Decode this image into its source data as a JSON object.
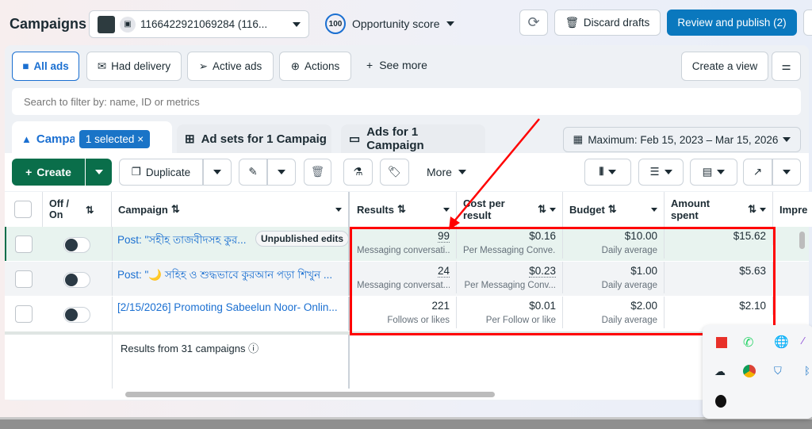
{
  "header": {
    "title": "Campaigns",
    "account": "1166422921069284 (116...",
    "opportunity_score": "100",
    "opportunity_label": "Opportunity score",
    "discard": "Discard drafts",
    "publish": "Review and publish (2)"
  },
  "filters": {
    "items": [
      "All ads",
      "Had delivery",
      "Active ads",
      "Actions"
    ],
    "see_more": "See more",
    "create_view": "Create a view"
  },
  "search": {
    "placeholder": "Search to filter by: name, ID or metrics"
  },
  "tabs": {
    "campaigns": "Campai",
    "selected": "1 selected",
    "adsets": "Ad sets for 1 Campaig",
    "ads": "Ads for 1 Campaign"
  },
  "date_range": "Maximum: Feb 15, 2023 – Mar 15, 2026",
  "toolbar": {
    "create": "Create",
    "duplicate": "Duplicate",
    "more": "More"
  },
  "table": {
    "headers": {
      "toggle": "Off / On",
      "campaign": "Campaign",
      "results": "Results",
      "cost": "Cost per result",
      "budget": "Budget",
      "amount": "Amount spent",
      "impressions": "Impre"
    },
    "rows": [
      {
        "name": "Post: \"সহীহ তাজবীদসহ কুর...",
        "badge": "Unpublished edits",
        "results": "99",
        "results_sub": "Messaging conversati...",
        "cost": "$0.16",
        "cost_sub": "Per Messaging Conve...",
        "budget": "$10.00",
        "budget_sub": "Daily average",
        "spent": "$15.62"
      },
      {
        "name": "Post: \"🌙 সহিহ ও শুদ্ধভাবে কুরআন পড়া শিখুন ...",
        "badge": "",
        "results": "24",
        "results_sub": "Messaging conversat...",
        "cost": "$0.23",
        "cost_sub": "Per Messaging Conv...",
        "budget": "$1.00",
        "budget_sub": "Daily average",
        "spent": "$5.63"
      },
      {
        "name": "[2/15/2026] Promoting Sabeelun Noor- Onlin...",
        "badge": "",
        "results": "221",
        "results_sub": "Follows or likes",
        "cost": "$0.01",
        "cost_sub": "Per Follow or like",
        "budget": "$2.00",
        "budget_sub": "Daily average",
        "spent": "$2.10"
      }
    ],
    "footer": "Results from 31 campaigns"
  },
  "colors": {
    "publish": "#0a78be",
    "create": "#0a6e4a",
    "highlight": "#ff0000"
  }
}
